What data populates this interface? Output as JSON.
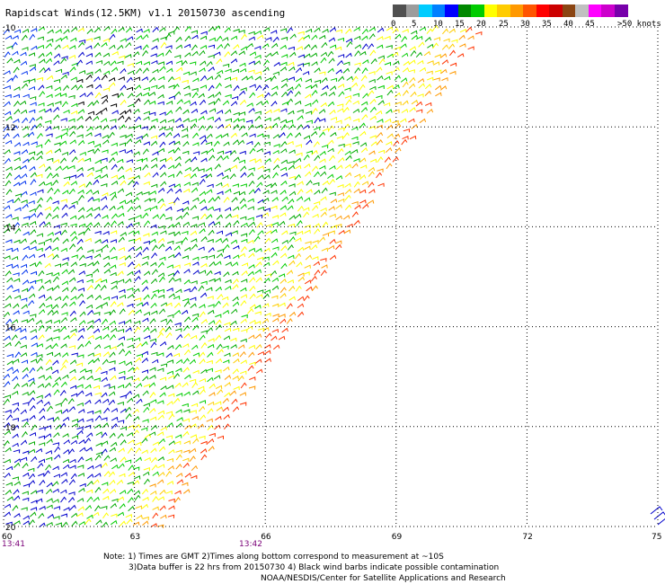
{
  "title": "Rapidscat Winds(12.5KM) v1.1 20150730 ascending",
  "legend": {
    "colors": [
      "#505050",
      "#9c9c9c",
      "#00ccff",
      "#0080ff",
      "#0000ff",
      "#008800",
      "#00cc00",
      "#ffff00",
      "#ffcc00",
      "#ff9900",
      "#ff5500",
      "#ff0000",
      "#cc0000",
      "#8b4513",
      "#c0c0c0",
      "#ff00ff",
      "#cc00cc",
      "#7700aa"
    ],
    "labels": [
      "0",
      "5",
      "10",
      "15",
      "20",
      "25",
      "30",
      "35",
      "40",
      "45",
      ">50 knots"
    ]
  },
  "axes": {
    "lon_labels": [
      "60",
      "63",
      "66",
      "69",
      "72",
      "75"
    ],
    "lat_labels": [
      "10",
      "12",
      "14",
      "16",
      "18",
      "20"
    ],
    "time_labels": [
      "13:41",
      "13:42"
    ]
  },
  "swath_colors": [
    "#0000cc",
    "#00aa00",
    "#00cc00",
    "#0033ee",
    "#33aa00",
    "#ffff00",
    "#ffcc00",
    "#ff9900",
    "#ff3300",
    "#000000"
  ],
  "notes": [
    "Note: 1) Times are GMT 2)Times along bottom correspond to measurement at ~10S",
    "3)Data buffer is 22 hrs from 20150730 4) Black wind barbs indicate possible contamination",
    "NOAA/NESDIS/Center for Satellite Applications and Research"
  ]
}
